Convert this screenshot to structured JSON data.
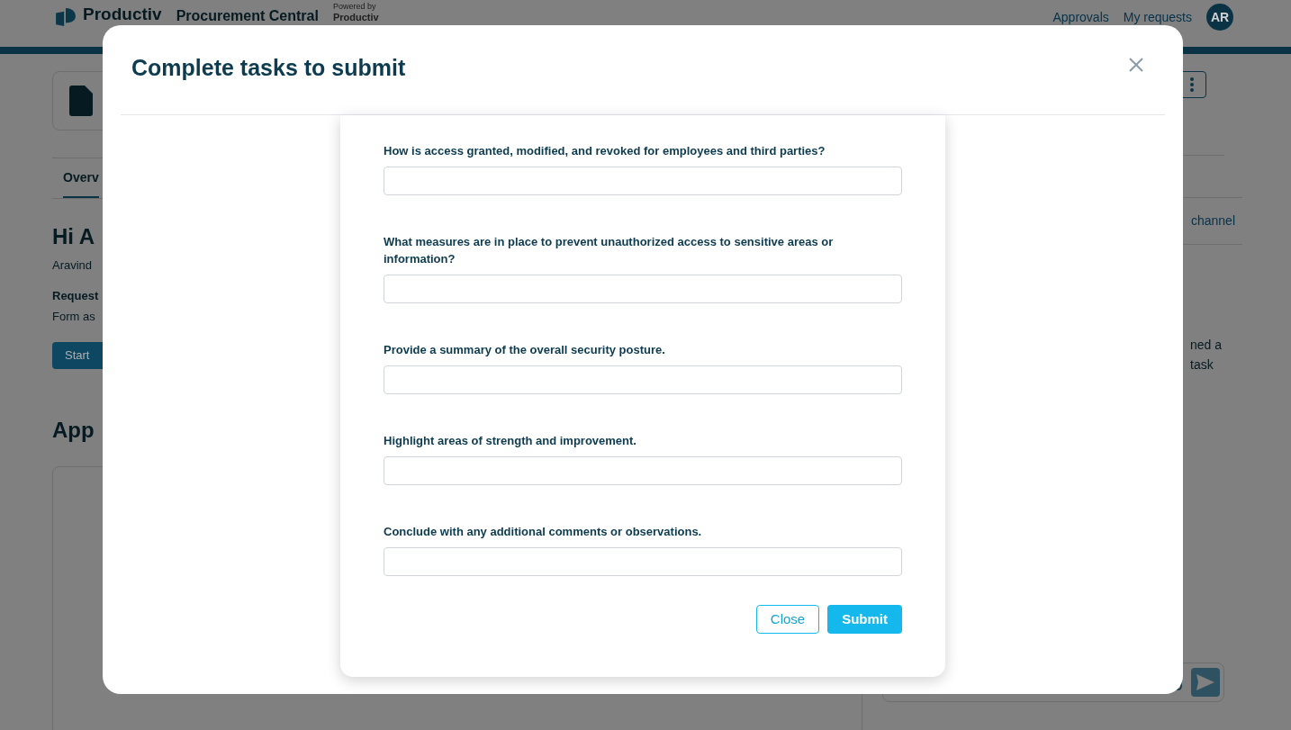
{
  "header": {
    "brand": "Productiv",
    "app_title": "Procurement Central",
    "powered_by": "Powered by",
    "powered_brand": "Productiv",
    "nav": [
      "Approvals",
      "My requests"
    ],
    "avatar": "AR"
  },
  "page": {
    "tab": "Overv",
    "greeting": "Hi A",
    "subtitle": "Aravind",
    "request_label": "Request",
    "request_text": "Form as",
    "start_button": "Start",
    "approvals_heading": "App"
  },
  "side_panel": {
    "channel_link": "channel",
    "message_lines": [
      "ned a",
      "task"
    ]
  },
  "modal": {
    "title": "Complete tasks to submit",
    "questions": [
      {
        "label": "How is access granted, modified, and revoked for employees and third parties?"
      },
      {
        "label": "What measures are in place to prevent unauthorized access to sensitive areas or information?"
      },
      {
        "label": "Provide a summary of the overall security posture."
      },
      {
        "label": "Highlight areas of strength and improvement."
      },
      {
        "label": "Conclude with any additional comments or observations."
      }
    ],
    "buttons": [
      {
        "label": "Close",
        "kind": "secondary"
      },
      {
        "label": "Submit",
        "kind": "primary"
      }
    ]
  }
}
